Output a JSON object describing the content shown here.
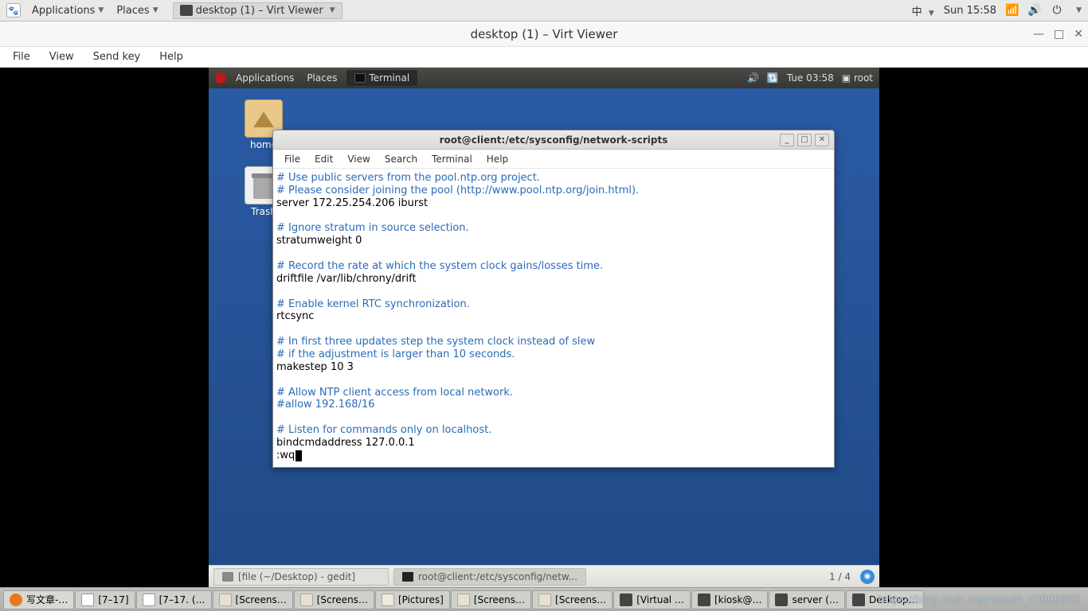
{
  "outer_panel": {
    "applications": "Applications",
    "places": "Places",
    "task_virt": "desktop (1) – Virt Viewer",
    "ime": "中",
    "clock": "Sun 15:58"
  },
  "virt": {
    "title": "desktop (1) – Virt Viewer",
    "menu": {
      "file": "File",
      "view": "View",
      "sendkey": "Send key",
      "help": "Help"
    }
  },
  "vm_panel": {
    "applications": "Applications",
    "places": "Places",
    "task_terminal": "Terminal",
    "clock": "Tue 03:58",
    "user": "root"
  },
  "desktop": {
    "home": "home",
    "trash": "Trash"
  },
  "terminal": {
    "title": "root@client:/etc/sysconfig/network-scripts",
    "menu": {
      "file": "File",
      "edit": "Edit",
      "view": "View",
      "search": "Search",
      "terminal": "Terminal",
      "help": "Help"
    },
    "lines": {
      "l1": "# Use public servers from the pool.ntp.org project.",
      "l2": "# Please consider joining the pool (http://www.pool.ntp.org/join.html).",
      "l3": "server 172.25.254.206 iburst",
      "l4": "# Ignore stratum in source selection.",
      "l5": "stratumweight 0",
      "l6": "# Record the rate at which the system clock gains/losses time.",
      "l7": "driftfile /var/lib/chrony/drift",
      "l8": "# Enable kernel RTC synchronization.",
      "l9": "rtcsync",
      "l10": "# In first three updates step the system clock instead of slew",
      "l11": "# if the adjustment is larger than 10 seconds.",
      "l12": "makestep 10 3",
      "l13": "# Allow NTP client access from local network.",
      "l14": "#allow 192.168/16",
      "l15": "# Listen for commands only on localhost.",
      "l16": "bindcmdaddress 127.0.0.1",
      "cmd": ":wq"
    }
  },
  "vm_taskbar": {
    "gedit": "[file (~/Desktop) - gedit]",
    "term": "root@client:/etc/sysconfig/netw...",
    "workspace": "1 / 4"
  },
  "outer_taskbar": {
    "t0": "写文章-…",
    "t1": "[7–17]",
    "t2": "[7–17. (…",
    "t3": "[Screens…",
    "t4": "[Screens…",
    "t5": "[Pictures]",
    "t6": "[Screens…",
    "t7": "[Screens…",
    "t8": "[Virtual …",
    "t9": "[kiosk@…",
    "t10": "server (…",
    "t11": "Desktop…"
  },
  "watermark": "https://blog.csdn.net/weixin_42996809"
}
